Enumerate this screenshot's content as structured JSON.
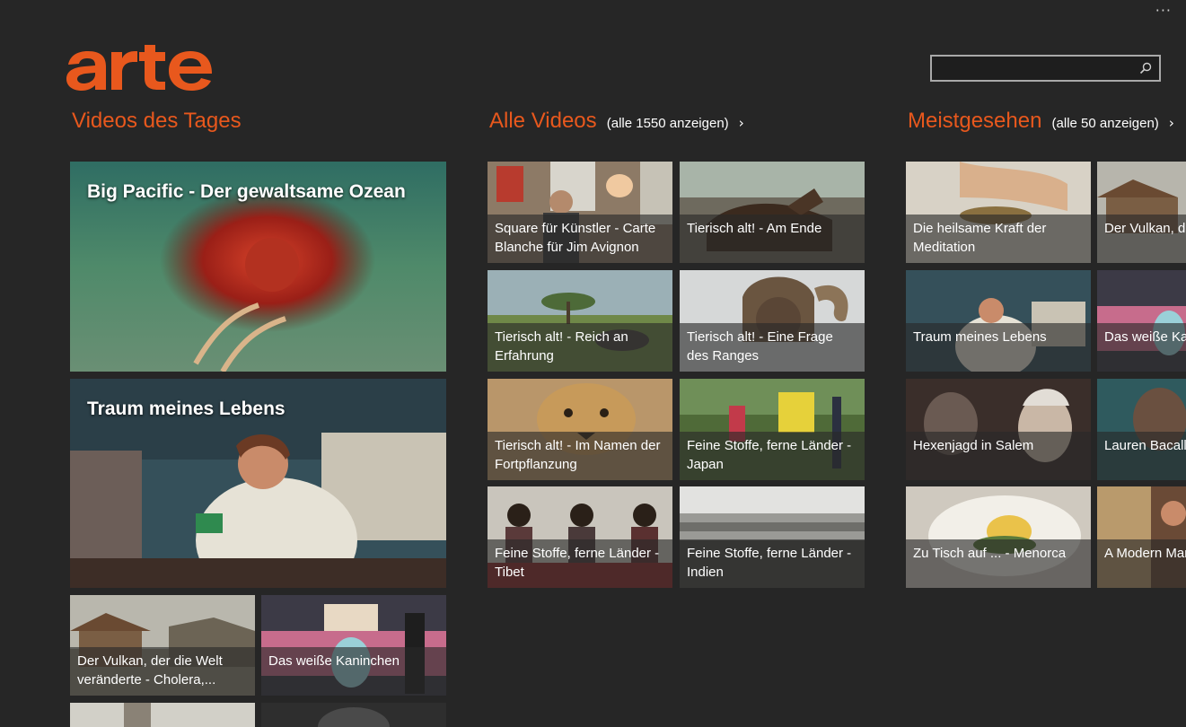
{
  "window": {
    "menu_dots": "···"
  },
  "brand": {
    "name": "arte",
    "color": "#e8581d"
  },
  "search": {
    "value": "",
    "placeholder": "",
    "icon": "search-icon"
  },
  "sections": {
    "today": {
      "title": "Videos des Tages"
    },
    "all": {
      "title": "Alle Videos",
      "link": "(alle 1550 anzeigen)",
      "chevron": "›"
    },
    "popular": {
      "title": "Meistgesehen",
      "link": "(alle 50 anzeigen)",
      "chevron": "›"
    }
  },
  "today": {
    "featured": [
      {
        "title": "Big Pacific - Der gewaltsame Ozean"
      },
      {
        "title": "Traum meines Lebens"
      }
    ],
    "small": [
      {
        "title": "Der Vulkan, der die Welt veränderte - Cholera,..."
      },
      {
        "title": "Das weiße Kaninchen"
      }
    ]
  },
  "all_videos": [
    {
      "title": "Square für Künstler - Carte Blanche für Jim Avignon"
    },
    {
      "title": "Tierisch alt! - Am Ende"
    },
    {
      "title": "Tierisch alt! - Reich an Erfahrung"
    },
    {
      "title": "Tierisch alt! - Eine Frage des Ranges"
    },
    {
      "title": "Tierisch alt! - Im Namen der Fortpflanzung"
    },
    {
      "title": "Feine Stoffe, ferne Länder - Japan"
    },
    {
      "title": "Feine Stoffe, ferne Länder - Tibet"
    },
    {
      "title": "Feine Stoffe, ferne Länder - Indien"
    }
  ],
  "most_viewed": [
    {
      "title": "Die heilsame Kraft der Meditation"
    },
    {
      "title": "Der Vulkan, der die Welt veränderte - Ch"
    },
    {
      "title": "Traum meines Lebens"
    },
    {
      "title": "Das weiße Kaninchen"
    },
    {
      "title": "Hexenjagd in Salem"
    },
    {
      "title": "Lauren Bacall - Verführerin"
    },
    {
      "title": "Zu Tisch auf ... - Menorca"
    },
    {
      "title": "A Modern Man"
    }
  ]
}
